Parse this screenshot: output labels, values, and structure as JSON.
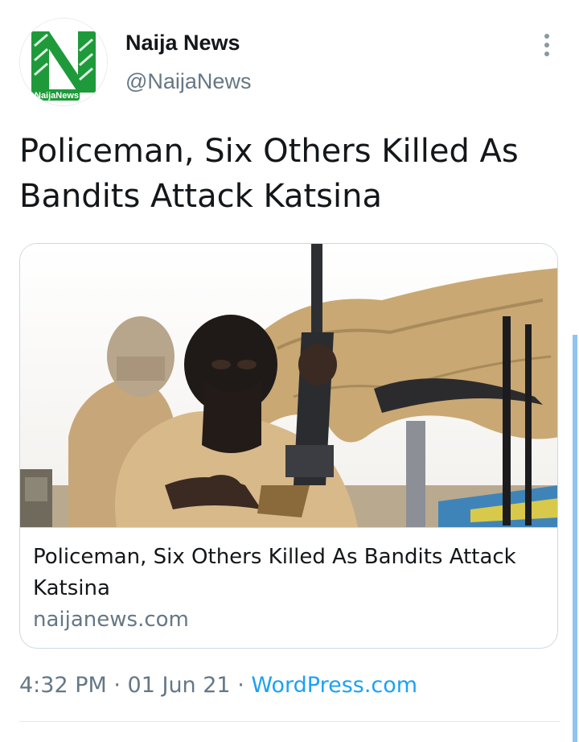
{
  "author": {
    "display_name": "Naija News",
    "handle": "@NaijaNews",
    "avatar_logo_text": "NaijaNews",
    "avatar_colors": {
      "primary": "#1e9a3a",
      "secondary": "#ffffff"
    }
  },
  "more_icon": "vertical-ellipsis-icon",
  "tweet": {
    "text": "Policeman, Six Others Killed As Bandits Attack Katsina"
  },
  "link_card": {
    "image_description_icon": "photo",
    "title": "Policeman, Six Others Killed As Bandits Attack Katsina",
    "domain": "naijanews.com"
  },
  "meta": {
    "time": "4:32 PM",
    "separator": " · ",
    "date": "01 Jun 21",
    "source": "WordPress.com"
  },
  "colors": {
    "text": "#14171a",
    "secondary_text": "#657786",
    "link": "#1da1f2",
    "border": "#cfd9de"
  }
}
